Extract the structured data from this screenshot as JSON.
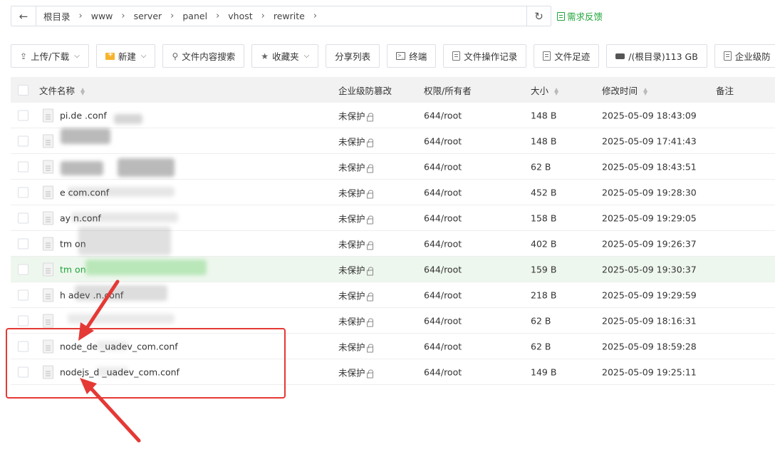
{
  "breadcrumb": [
    "根目录",
    "www",
    "server",
    "panel",
    "vhost",
    "rewrite"
  ],
  "feedback_label": "需求反馈",
  "toolbar": {
    "upload": "上传/下载",
    "new": "新建",
    "search": "文件内容搜索",
    "favorites": "收藏夹",
    "share": "分享列表",
    "terminal": "终端",
    "oplog": "文件操作记录",
    "footprint": "文件足迹",
    "disk": "/(根目录)113 GB",
    "enterprise": "企业级防"
  },
  "columns": {
    "name": "文件名称",
    "protect": "企业级防篡改",
    "perm": "权限/所有者",
    "size": "大小",
    "mtime": "修改时间",
    "note": "备注"
  },
  "files": [
    {
      "name": "pi.de                 .conf",
      "protect": "未保护",
      "perm": "644/root",
      "size": "148 B",
      "mtime": "2025-05-09 18:43:09"
    },
    {
      "name": "",
      "protect": "未保护",
      "perm": "644/root",
      "size": "148 B",
      "mtime": "2025-05-09 17:41:43"
    },
    {
      "name": "",
      "protect": "未保护",
      "perm": "644/root",
      "size": "62 B",
      "mtime": "2025-05-09 18:43:51"
    },
    {
      "name": "                      e   com.conf",
      "protect": "未保护",
      "perm": "644/root",
      "size": "452 B",
      "mtime": "2025-05-09 19:28:30"
    },
    {
      "name": "               ay           n.conf",
      "protect": "未保护",
      "perm": "644/root",
      "size": "158 B",
      "mtime": "2025-05-09 19:29:05"
    },
    {
      "name": "tm                          on",
      "protect": "未保护",
      "perm": "644/root",
      "size": "402 B",
      "mtime": "2025-05-09 19:26:37"
    },
    {
      "name": "tm                            on",
      "protect": "未保护",
      "perm": "644/root",
      "size": "159 B",
      "mtime": "2025-05-09 19:30:37"
    },
    {
      "name": "h                      adev   .n.conf",
      "protect": "未保护",
      "perm": "644/root",
      "size": "218 B",
      "mtime": "2025-05-09 19:29:59"
    },
    {
      "name": "",
      "protect": "未保护",
      "perm": "644/root",
      "size": "62 B",
      "mtime": "2025-05-09 18:16:31"
    },
    {
      "name": "node_de          _uadev_com.conf",
      "protect": "未保护",
      "perm": "644/root",
      "size": "62 B",
      "mtime": "2025-05-09 18:59:28"
    },
    {
      "name": "nodejs_d          _uadev_com.conf",
      "protect": "未保护",
      "perm": "644/root",
      "size": "149 B",
      "mtime": "2025-05-09 19:25:11"
    }
  ]
}
